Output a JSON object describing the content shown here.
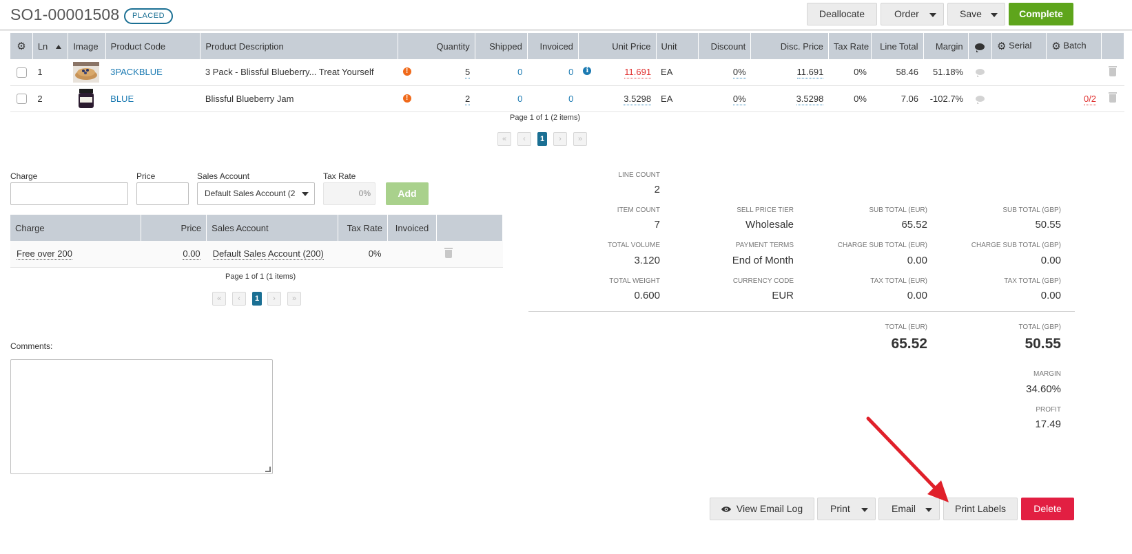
{
  "header": {
    "order_number": "SO1-00001508",
    "status": "PLACED",
    "buttons": {
      "deallocate": "Deallocate",
      "order": "Order",
      "save": "Save",
      "complete": "Complete"
    }
  },
  "lines_table": {
    "columns": [
      "Ln",
      "Image",
      "Product Code",
      "Product Description",
      "Quantity",
      "Shipped",
      "Invoiced",
      "Unit Price",
      "Unit",
      "Discount",
      "Disc. Price",
      "Tax Rate",
      "Line Total",
      "Margin",
      "Serial",
      "Batch"
    ],
    "rows": [
      {
        "ln": "1",
        "image": "blueberry-pancakes-thumbnail",
        "product_code": "3PACKBLUE",
        "description": "3 Pack - Blissful Blueberry... Treat Yourself",
        "quantity": "5",
        "shipped": "0",
        "invoiced": "0",
        "unit_price": "11.691",
        "unit": "EA",
        "discount": "0%",
        "disc_price": "11.691",
        "tax_rate": "0%",
        "line_total": "58.46",
        "margin": "51.18%",
        "batch": ""
      },
      {
        "ln": "2",
        "image": "jam-jar-thumbnail",
        "product_code": "BLUE",
        "description": "Blissful Blueberry Jam",
        "quantity": "2",
        "shipped": "0",
        "invoiced": "0",
        "unit_price": "3.5298",
        "unit": "EA",
        "discount": "0%",
        "disc_price": "3.5298",
        "tax_rate": "0%",
        "line_total": "7.06",
        "margin": "-102.7%",
        "batch": "0/2"
      }
    ],
    "pager_text": "Page 1 of 1 (2 items)",
    "current_page": "1"
  },
  "charge_form": {
    "charge_label": "Charge",
    "price_label": "Price",
    "sales_account_label": "Sales Account",
    "sales_account_value": "Default Sales Account (2",
    "tax_rate_label": "Tax Rate",
    "tax_rate_value": "0%",
    "add_button": "Add"
  },
  "charges_table": {
    "columns": [
      "Charge",
      "Price",
      "Sales Account",
      "Tax Rate",
      "Invoiced"
    ],
    "rows": [
      {
        "charge": "Free over 200",
        "price": "0.00",
        "sales_account": "Default Sales Account (200)",
        "tax_rate": "0%",
        "invoiced": ""
      }
    ],
    "pager_text": "Page 1 of 1 (1 items)",
    "current_page": "1"
  },
  "comments": {
    "label": "Comments:",
    "value": ""
  },
  "summary": {
    "line_count_label": "LINE COUNT",
    "line_count": "2",
    "item_count_label": "ITEM COUNT",
    "item_count": "7",
    "total_volume_label": "TOTAL VOLUME",
    "total_volume": "3.120",
    "total_weight_label": "TOTAL WEIGHT",
    "total_weight": "0.600",
    "sell_price_tier_label": "SELL PRICE TIER",
    "sell_price_tier": "Wholesale",
    "payment_terms_label": "PAYMENT TERMS",
    "payment_terms": "End of Month",
    "currency_code_label": "CURRENCY CODE",
    "currency_code": "EUR",
    "sub_total_eur_label": "SUB TOTAL (EUR)",
    "sub_total_eur": "65.52",
    "charge_sub_total_eur_label": "CHARGE SUB TOTAL (EUR)",
    "charge_sub_total_eur": "0.00",
    "tax_total_eur_label": "TAX TOTAL (EUR)",
    "tax_total_eur": "0.00",
    "sub_total_gbp_label": "SUB TOTAL (GBP)",
    "sub_total_gbp": "50.55",
    "charge_sub_total_gbp_label": "CHARGE SUB TOTAL (GBP)",
    "charge_sub_total_gbp": "0.00",
    "tax_total_gbp_label": "TAX TOTAL (GBP)",
    "tax_total_gbp": "0.00",
    "total_eur_label": "TOTAL (EUR)",
    "total_eur": "65.52",
    "total_gbp_label": "TOTAL (GBP)",
    "total_gbp": "50.55",
    "margin_label": "MARGIN",
    "margin": "34.60%",
    "profit_label": "PROFIT",
    "profit": "17.49"
  },
  "footer_buttons": {
    "view_email_log": "View Email Log",
    "print": "Print",
    "email": "Email",
    "print_labels": "Print Labels",
    "delete": "Delete"
  },
  "colors": {
    "accent": "#1a6f93",
    "complete_green": "#5ea51c",
    "delete_red": "#e21f42",
    "annotation_arrow": "#e0202a"
  }
}
